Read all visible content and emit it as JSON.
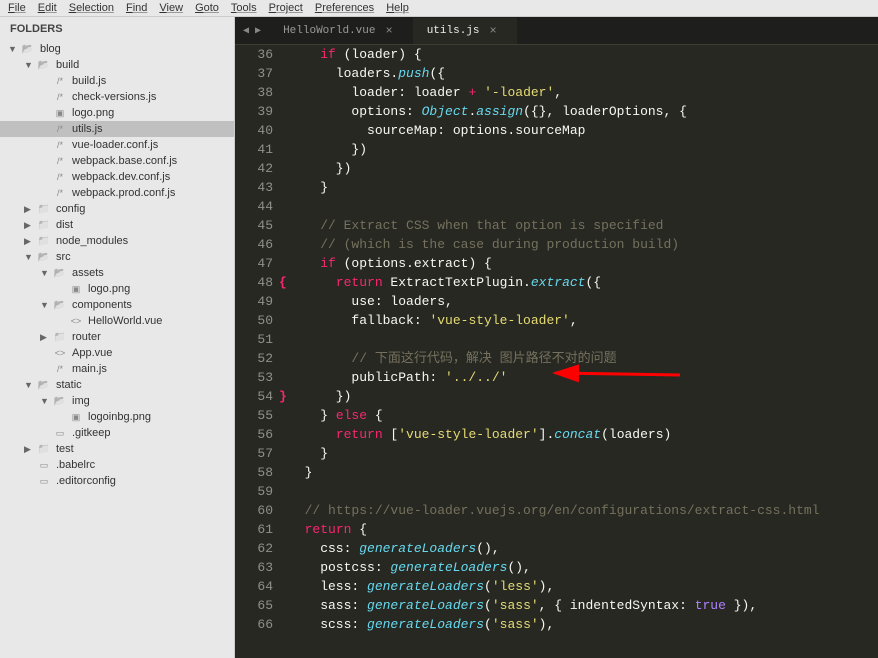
{
  "menubar": [
    "File",
    "Edit",
    "Selection",
    "Find",
    "View",
    "Goto",
    "Tools",
    "Project",
    "Preferences",
    "Help"
  ],
  "sidebar": {
    "header": "FOLDERS",
    "tree": [
      {
        "depth": 0,
        "type": "folder",
        "open": true,
        "label": "blog"
      },
      {
        "depth": 1,
        "type": "folder",
        "open": true,
        "label": "build"
      },
      {
        "depth": 2,
        "type": "js",
        "label": "build.js"
      },
      {
        "depth": 2,
        "type": "js",
        "label": "check-versions.js"
      },
      {
        "depth": 2,
        "type": "img",
        "label": "logo.png"
      },
      {
        "depth": 2,
        "type": "js",
        "label": "utils.js",
        "selected": true
      },
      {
        "depth": 2,
        "type": "js",
        "label": "vue-loader.conf.js"
      },
      {
        "depth": 2,
        "type": "js",
        "label": "webpack.base.conf.js"
      },
      {
        "depth": 2,
        "type": "js",
        "label": "webpack.dev.conf.js"
      },
      {
        "depth": 2,
        "type": "js",
        "label": "webpack.prod.conf.js"
      },
      {
        "depth": 1,
        "type": "folder",
        "open": false,
        "label": "config"
      },
      {
        "depth": 1,
        "type": "folder",
        "open": false,
        "label": "dist"
      },
      {
        "depth": 1,
        "type": "folder",
        "open": false,
        "label": "node_modules"
      },
      {
        "depth": 1,
        "type": "folder",
        "open": true,
        "label": "src"
      },
      {
        "depth": 2,
        "type": "folder",
        "open": true,
        "label": "assets"
      },
      {
        "depth": 3,
        "type": "img",
        "label": "logo.png"
      },
      {
        "depth": 2,
        "type": "folder",
        "open": true,
        "label": "components"
      },
      {
        "depth": 3,
        "type": "code",
        "label": "HelloWorld.vue"
      },
      {
        "depth": 2,
        "type": "folder",
        "open": false,
        "label": "router"
      },
      {
        "depth": 2,
        "type": "code",
        "label": "App.vue"
      },
      {
        "depth": 2,
        "type": "js",
        "label": "main.js"
      },
      {
        "depth": 1,
        "type": "folder",
        "open": true,
        "label": "static"
      },
      {
        "depth": 2,
        "type": "folder",
        "open": true,
        "label": "img"
      },
      {
        "depth": 3,
        "type": "img",
        "label": "logoinbg.png"
      },
      {
        "depth": 2,
        "type": "file",
        "label": ".gitkeep"
      },
      {
        "depth": 1,
        "type": "folder",
        "open": false,
        "label": "test"
      },
      {
        "depth": 1,
        "type": "file",
        "label": ".babelrc"
      },
      {
        "depth": 1,
        "type": "file",
        "label": ".editorconfig"
      }
    ]
  },
  "tabs": [
    {
      "label": "HelloWorld.vue",
      "active": false
    },
    {
      "label": "utils.js",
      "active": true
    }
  ],
  "code": {
    "startLine": 36,
    "lines": [
      {
        "n": 36,
        "tokens": [
          [
            "id",
            "    "
          ],
          [
            "kw",
            "if"
          ],
          [
            "id",
            " (loader) {"
          ]
        ]
      },
      {
        "n": 37,
        "tokens": [
          [
            "id",
            "      loaders."
          ],
          [
            "fn",
            "push"
          ],
          [
            "id",
            "({"
          ]
        ]
      },
      {
        "n": 38,
        "tokens": [
          [
            "id",
            "        loader: loader "
          ],
          [
            "op",
            "+"
          ],
          [
            "id",
            " "
          ],
          [
            "str",
            "'-loader'"
          ],
          [
            "id",
            ","
          ]
        ]
      },
      {
        "n": 39,
        "tokens": [
          [
            "id",
            "        options: "
          ],
          [
            "obj",
            "Object"
          ],
          [
            "id",
            "."
          ],
          [
            "fn",
            "assign"
          ],
          [
            "id",
            "({}, loaderOptions, {"
          ]
        ]
      },
      {
        "n": 40,
        "tokens": [
          [
            "id",
            "          sourceMap: options.sourceMap"
          ]
        ]
      },
      {
        "n": 41,
        "tokens": [
          [
            "id",
            "        })"
          ]
        ]
      },
      {
        "n": 42,
        "tokens": [
          [
            "id",
            "      })"
          ]
        ]
      },
      {
        "n": 43,
        "tokens": [
          [
            "id",
            "    }"
          ]
        ]
      },
      {
        "n": 44,
        "tokens": [
          [
            "id",
            ""
          ]
        ]
      },
      {
        "n": 45,
        "tokens": [
          [
            "id",
            "    "
          ],
          [
            "cmt",
            "// Extract CSS when that option is specified"
          ]
        ]
      },
      {
        "n": 46,
        "tokens": [
          [
            "id",
            "    "
          ],
          [
            "cmt",
            "// (which is the case during production build)"
          ]
        ]
      },
      {
        "n": 47,
        "tokens": [
          [
            "id",
            "    "
          ],
          [
            "kw",
            "if"
          ],
          [
            "id",
            " (options.extract) {"
          ]
        ]
      },
      {
        "n": 48,
        "bracket": "{",
        "tokens": [
          [
            "id",
            "      "
          ],
          [
            "kw",
            "return"
          ],
          [
            "id",
            " ExtractTextPlugin."
          ],
          [
            "fn",
            "extract"
          ],
          [
            "id",
            "({"
          ]
        ]
      },
      {
        "n": 49,
        "tokens": [
          [
            "id",
            "        use: loaders,"
          ]
        ]
      },
      {
        "n": 50,
        "tokens": [
          [
            "id",
            "        fallback: "
          ],
          [
            "str",
            "'vue-style-loader'"
          ],
          [
            "id",
            ","
          ]
        ]
      },
      {
        "n": 51,
        "tokens": [
          [
            "id",
            ""
          ]
        ]
      },
      {
        "n": 52,
        "tokens": [
          [
            "id",
            "        "
          ],
          [
            "cmt",
            "// 下面这行代码，解决 图片路径不对的问题"
          ]
        ]
      },
      {
        "n": 53,
        "tokens": [
          [
            "id",
            "        publicPath: "
          ],
          [
            "str",
            "'../../'"
          ]
        ]
      },
      {
        "n": 54,
        "bracket": "}",
        "tokens": [
          [
            "id",
            "      })"
          ]
        ]
      },
      {
        "n": 55,
        "tokens": [
          [
            "id",
            "    } "
          ],
          [
            "kw",
            "else"
          ],
          [
            "id",
            " {"
          ]
        ]
      },
      {
        "n": 56,
        "tokens": [
          [
            "id",
            "      "
          ],
          [
            "kw",
            "return"
          ],
          [
            "id",
            " ["
          ],
          [
            "str",
            "'vue-style-loader'"
          ],
          [
            "id",
            "]."
          ],
          [
            "fn",
            "concat"
          ],
          [
            "id",
            "(loaders)"
          ]
        ]
      },
      {
        "n": 57,
        "tokens": [
          [
            "id",
            "    }"
          ]
        ]
      },
      {
        "n": 58,
        "tokens": [
          [
            "id",
            "  }"
          ]
        ]
      },
      {
        "n": 59,
        "tokens": [
          [
            "id",
            ""
          ]
        ]
      },
      {
        "n": 60,
        "tokens": [
          [
            "id",
            "  "
          ],
          [
            "cmt",
            "// https://vue-loader.vuejs.org/en/configurations/extract-css.html"
          ]
        ]
      },
      {
        "n": 61,
        "tokens": [
          [
            "id",
            "  "
          ],
          [
            "kw",
            "return"
          ],
          [
            "id",
            " {"
          ]
        ]
      },
      {
        "n": 62,
        "tokens": [
          [
            "id",
            "    css: "
          ],
          [
            "fn",
            "generateLoaders"
          ],
          [
            "id",
            "(),"
          ]
        ]
      },
      {
        "n": 63,
        "tokens": [
          [
            "id",
            "    postcss: "
          ],
          [
            "fn",
            "generateLoaders"
          ],
          [
            "id",
            "(),"
          ]
        ]
      },
      {
        "n": 64,
        "tokens": [
          [
            "id",
            "    less: "
          ],
          [
            "fn",
            "generateLoaders"
          ],
          [
            "id",
            "("
          ],
          [
            "str",
            "'less'"
          ],
          [
            "id",
            "),"
          ]
        ]
      },
      {
        "n": 65,
        "tokens": [
          [
            "id",
            "    sass: "
          ],
          [
            "fn",
            "generateLoaders"
          ],
          [
            "id",
            "("
          ],
          [
            "str",
            "'sass'"
          ],
          [
            "id",
            ", { indentedSyntax: "
          ],
          [
            "const",
            "true"
          ],
          [
            "id",
            " }),"
          ]
        ]
      },
      {
        "n": 66,
        "tokens": [
          [
            "id",
            "    scss: "
          ],
          [
            "fn",
            "generateLoaders"
          ],
          [
            "id",
            "("
          ],
          [
            "str",
            "'sass'"
          ],
          [
            "id",
            "),"
          ]
        ]
      }
    ]
  }
}
